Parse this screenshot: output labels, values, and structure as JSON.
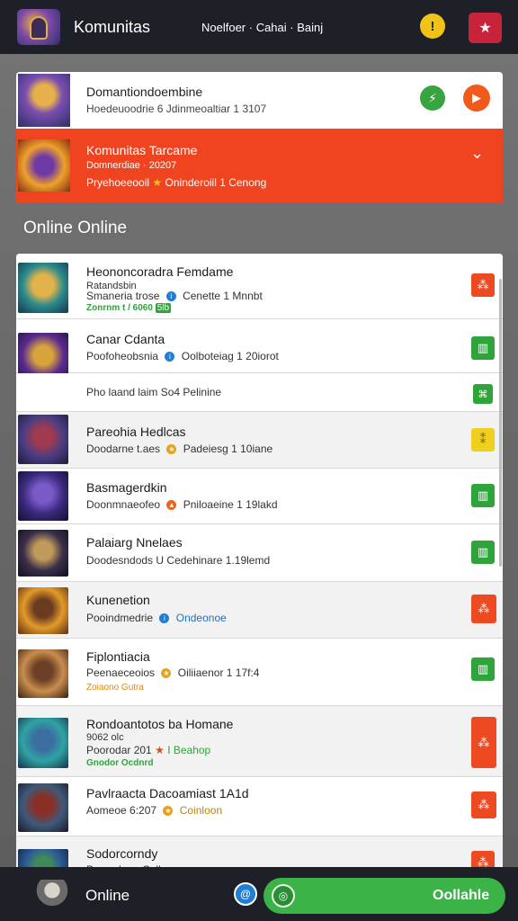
{
  "header": {
    "title": "Komunitas",
    "tagline": "Noelfoer · Cahai · Bainj",
    "yellow_icon": "alert-icon",
    "red_icon": "star-icon"
  },
  "pinned": [
    {
      "name": "Domantiondoembine",
      "sub": "Hoedeuoodrie  6 Jdinmeoaltiar 1 3107",
      "action1_glyph": "⚡",
      "action2_glyph": "▶"
    },
    {
      "name": "Komunitas Tarcame",
      "sub": "Domnerdiae · 20207",
      "sub2": "Pryehoeeooil",
      "sub2_badge": "★",
      "sub2_tail": "Oninderoiil 1 Cenong",
      "chevron": "⌄"
    }
  ],
  "section_title": "Online Online",
  "list": [
    {
      "name": "Heononcoradra Femdame",
      "l2": "Ratandsbin",
      "l3a": "Smaneria trose",
      "l3b": "Cenette 1 Mnnbt",
      "l4": "Zonrnm t / 6060",
      "badge": "5lb",
      "action": "⁂"
    },
    {
      "name": "Canar Cdanta",
      "l2": "Poofoheobsnia",
      "l3b": "Oolboteiag 1 20iorot",
      "action": "▥"
    },
    {
      "sub_only": "Pho laand laim  So4  Pelinine",
      "action": "⌘"
    },
    {
      "name": "Pareohia Hedlcas",
      "l2": "Doodarne t.aes",
      "l3b": "Padeiesg 1 10iane",
      "action": "⁑"
    },
    {
      "name": "Basmagerdkin",
      "l2": "Doonmnaeofeo",
      "l3b": "Pniloaeine 1 19lakd",
      "action": "▥"
    },
    {
      "name": "Palaiarg Nnelaes",
      "l2": "Doodesndods  U",
      "l3b": "Cedehinare 1.19lemd",
      "action": "▥"
    },
    {
      "name": "Kunenetion",
      "l2": "Pooindmedrie",
      "l3b": "Ondeonoe",
      "action": "⁂"
    },
    {
      "name": "Fiplontiacia",
      "l2": "Peenaeceoios",
      "l3b": "Oiliiaenor 1 17f:4",
      "l4": "Zoiaono Gutra",
      "action": "▥"
    },
    {
      "name": "Rondoantotos ba Homane",
      "l2": "9062 olc",
      "l3a": "Poorodar 201",
      "l3b": "I Beahop",
      "l4": "Gnodor Ocdnrd",
      "action": "⁂"
    },
    {
      "name": "Pavlraacta Dacoamiast  1A1d",
      "l2": "Aomeoe 6:207",
      "l3b": "Coinloon",
      "action": "⁂"
    },
    {
      "name": "Sodorcorndy",
      "l2": "Bonerdeoe",
      "l3b": "Cellneone",
      "action": "⁂"
    }
  ],
  "bottom": {
    "label": "Online",
    "cta_label": "Oollahle",
    "blue_glyph": "@",
    "cta_glyph": "◎"
  },
  "colors": {
    "accent_red": "#f0431f",
    "green": "#2ea43a",
    "yellow": "#f1cf1f",
    "dark_bar": "#1d2127"
  }
}
